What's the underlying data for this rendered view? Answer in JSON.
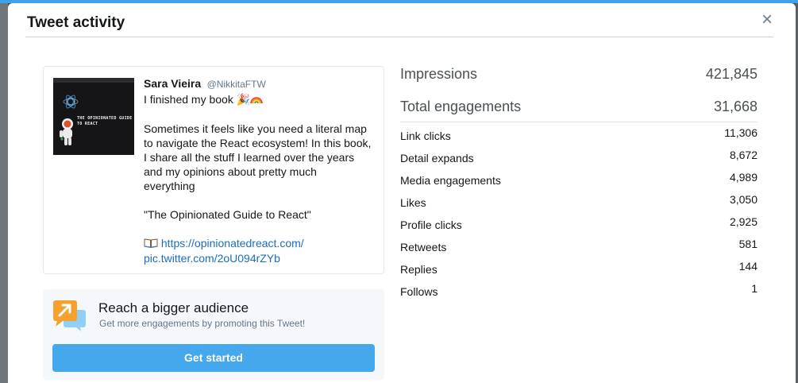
{
  "modal": {
    "title": "Tweet activity",
    "close_symbol": "×"
  },
  "tweet": {
    "author_name": "Sara Vieira",
    "author_handle": "@NikkitaFTW",
    "first_line": "I finished my book",
    "first_line_emojis": [
      "party-popper-icon",
      "rainbow-icon"
    ],
    "paragraph": "Sometimes it feels like you need a literal map\nto navigate the React ecosystem! In this book,\nI share all the stuff I learned over the years\nand my opinions about pretty much\neverything",
    "quote": "\"The Opinionated Guide to React\"",
    "link_url": "https://opinionatedreact.com/",
    "pic_link": "pic.twitter.com/2oU094rZYb",
    "media_title": "THE OPINIONATED GUIDE TO REACT"
  },
  "promote": {
    "heading": "Reach a bigger audience",
    "subtext": "Get more engagements by promoting this Tweet!",
    "button_label": "Get started",
    "icon": "promote-chat-arrow-icon"
  },
  "metrics": {
    "impressions": {
      "label": "Impressions",
      "value": "421,845"
    },
    "total_engagements": {
      "label": "Total engagements",
      "value": "31,668"
    },
    "breakdown": [
      {
        "label": "Link clicks",
        "value": "11,306"
      },
      {
        "label": "Detail expands",
        "value": "8,672"
      },
      {
        "label": "Media engagements",
        "value": "4,989"
      },
      {
        "label": "Likes",
        "value": "3,050"
      },
      {
        "label": "Profile clicks",
        "value": "2,925"
      },
      {
        "label": "Retweets",
        "value": "581"
      },
      {
        "label": "Replies",
        "value": "144"
      },
      {
        "label": "Follows",
        "value": "1"
      }
    ]
  },
  "colors": {
    "accent": "#45a7ec",
    "top_stripe": "#3ea1ec",
    "link": "#1b6dbd",
    "promote_icon_orange": "#f6a02d",
    "promote_icon_blue": "#8fd0f7"
  }
}
